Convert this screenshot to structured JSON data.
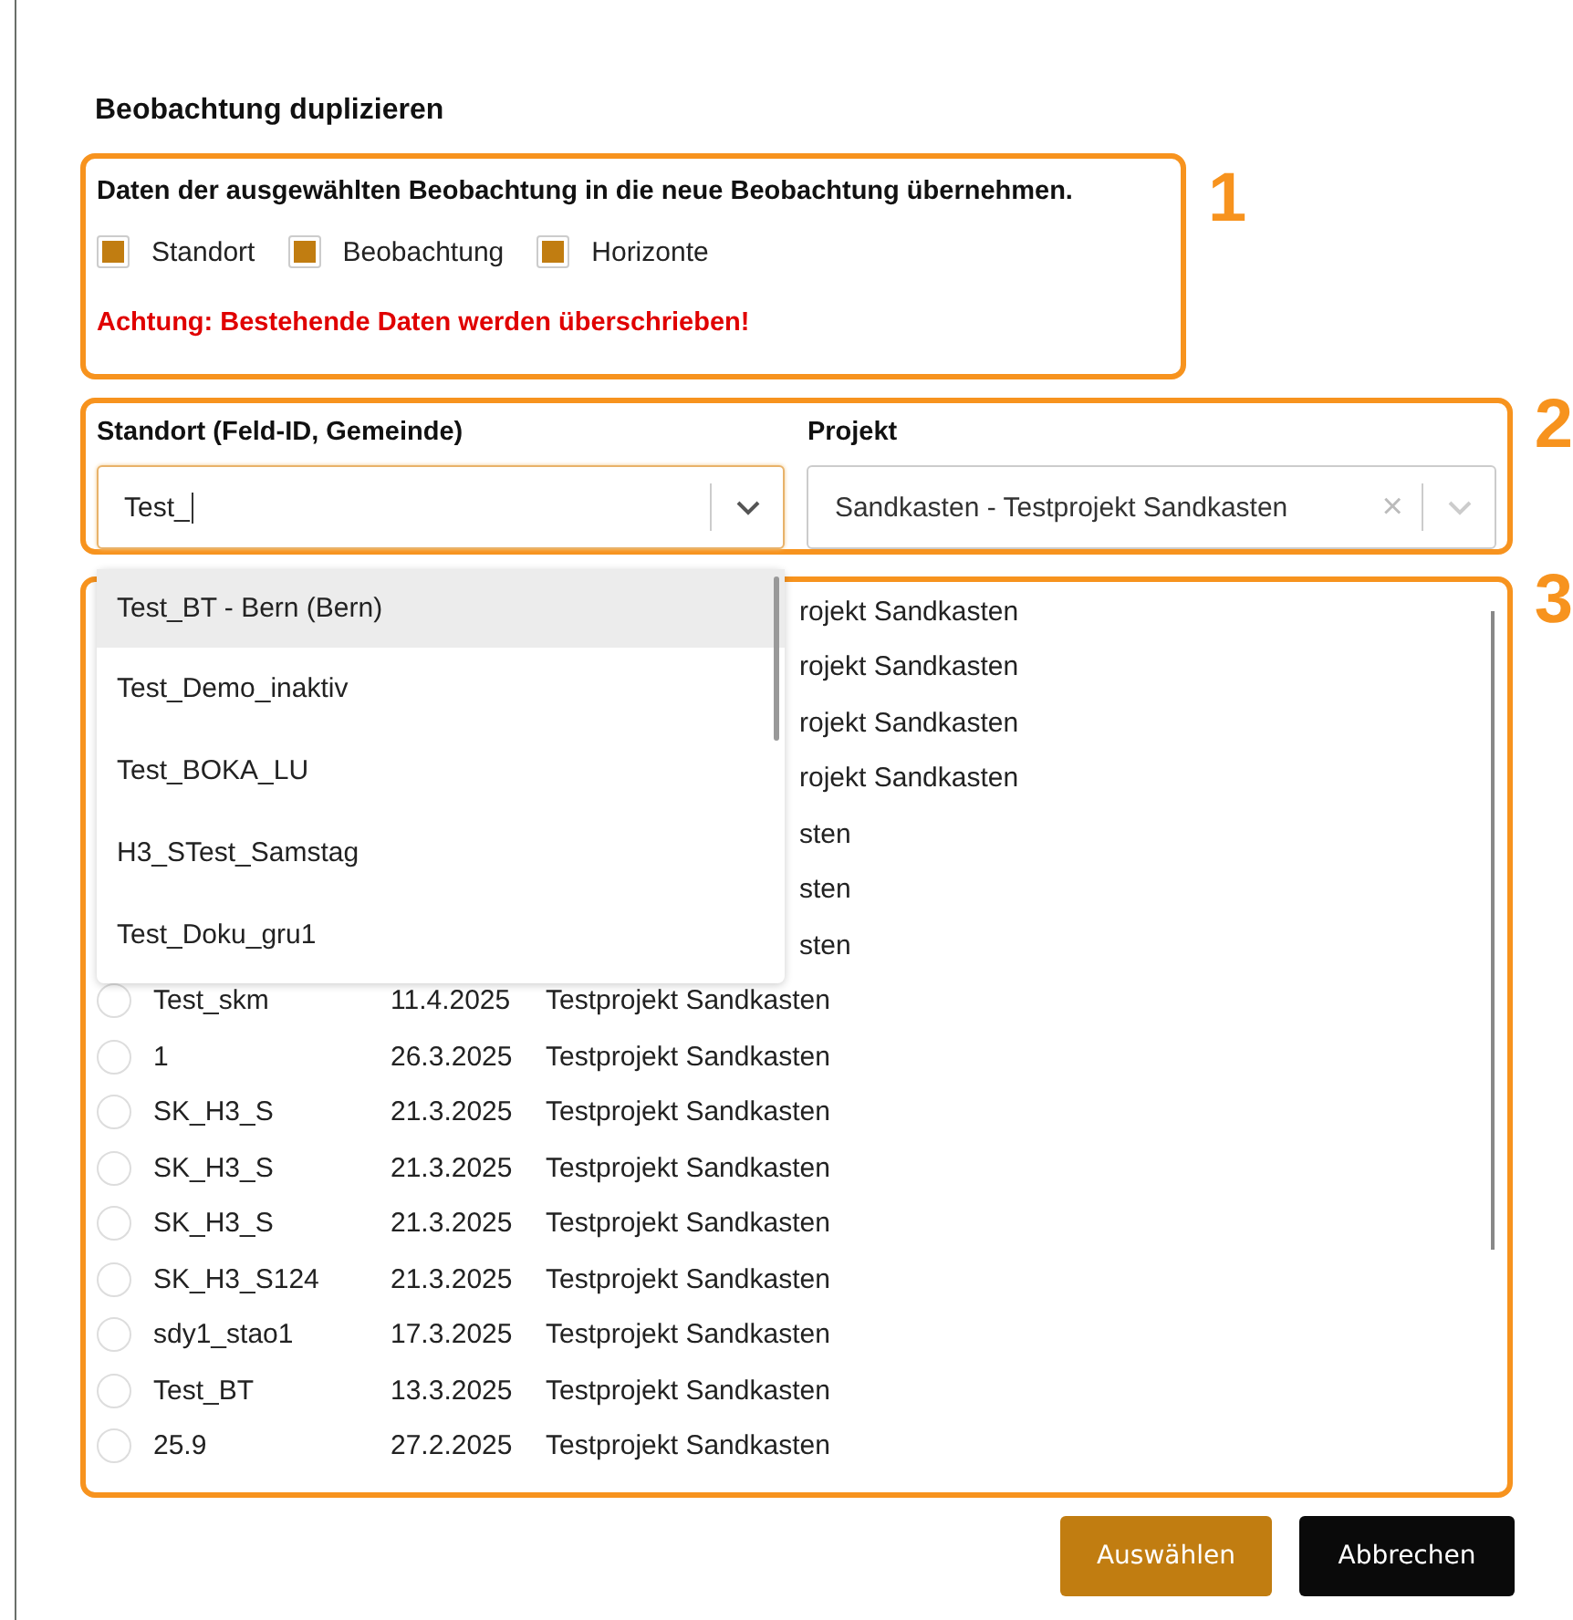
{
  "dialog": {
    "title": "Beobachtung duplizieren"
  },
  "section_1": {
    "number": "1",
    "instruction": "Daten der ausgewählten Beobachtung in die neue Beobachtung übernehmen.",
    "options": [
      {
        "label": "Standort",
        "checked": true
      },
      {
        "label": "Beobachtung",
        "checked": true
      },
      {
        "label": "Horizonte",
        "checked": true
      }
    ],
    "warning": "Achtung: Bestehende Daten werden überschrieben!"
  },
  "section_2": {
    "number": "2",
    "standort": {
      "label": "Standort (Feld-ID, Gemeinde)",
      "value": "Test_",
      "focused": true,
      "options": [
        {
          "label": "Test_BT - Bern (Bern)",
          "selected": true
        },
        {
          "label": "Test_Demo_inaktiv",
          "selected": false
        },
        {
          "label": "Test_BOKA_LU",
          "selected": false
        },
        {
          "label": "H3_STest_Samstag",
          "selected": false
        },
        {
          "label": "Test_Doku_gru1",
          "selected": false
        }
      ]
    },
    "projekt": {
      "label": "Projekt",
      "value": "Sandkasten - Testprojekt Sandkasten",
      "clear": "×"
    }
  },
  "section_3": {
    "number": "3",
    "rows": [
      {
        "kind": "covered",
        "visible_text": "rojekt Sandkasten"
      },
      {
        "kind": "covered",
        "visible_text": "rojekt Sandkasten"
      },
      {
        "kind": "covered",
        "visible_text": "rojekt Sandkasten"
      },
      {
        "kind": "covered",
        "visible_text": "rojekt Sandkasten"
      },
      {
        "kind": "covered",
        "visible_text": "sten"
      },
      {
        "kind": "covered",
        "visible_text": "sten"
      },
      {
        "kind": "covered",
        "visible_text": "sten"
      },
      {
        "kind": "full",
        "name": "Test_skm",
        "date": "11.4.2025",
        "project": "Testprojekt Sandkasten",
        "selected": false
      },
      {
        "kind": "full",
        "name": "1",
        "date": "26.3.2025",
        "project": "Testprojekt Sandkasten",
        "selected": false
      },
      {
        "kind": "full",
        "name": "SK_H3_S",
        "date": "21.3.2025",
        "project": "Testprojekt Sandkasten",
        "selected": false
      },
      {
        "kind": "full",
        "name": "SK_H3_S",
        "date": "21.3.2025",
        "project": "Testprojekt Sandkasten",
        "selected": false
      },
      {
        "kind": "full",
        "name": "SK_H3_S",
        "date": "21.3.2025",
        "project": "Testprojekt Sandkasten",
        "selected": false
      },
      {
        "kind": "full",
        "name": "SK_H3_S124",
        "date": "21.3.2025",
        "project": "Testprojekt Sandkasten",
        "selected": false
      },
      {
        "kind": "full",
        "name": "sdy1_stao1",
        "date": "17.3.2025",
        "project": "Testprojekt Sandkasten",
        "selected": false
      },
      {
        "kind": "full",
        "name": "Test_BT",
        "date": "13.3.2025",
        "project": "Testprojekt Sandkasten",
        "selected": false
      },
      {
        "kind": "full",
        "name": "25.9",
        "date": "27.2.2025",
        "project": "Testprojekt Sandkasten",
        "selected": false
      }
    ]
  },
  "buttons": [
    {
      "label": "Auswählen",
      "kind": "primary"
    },
    {
      "label": "Abbrechen",
      "kind": "secondary"
    }
  ]
}
